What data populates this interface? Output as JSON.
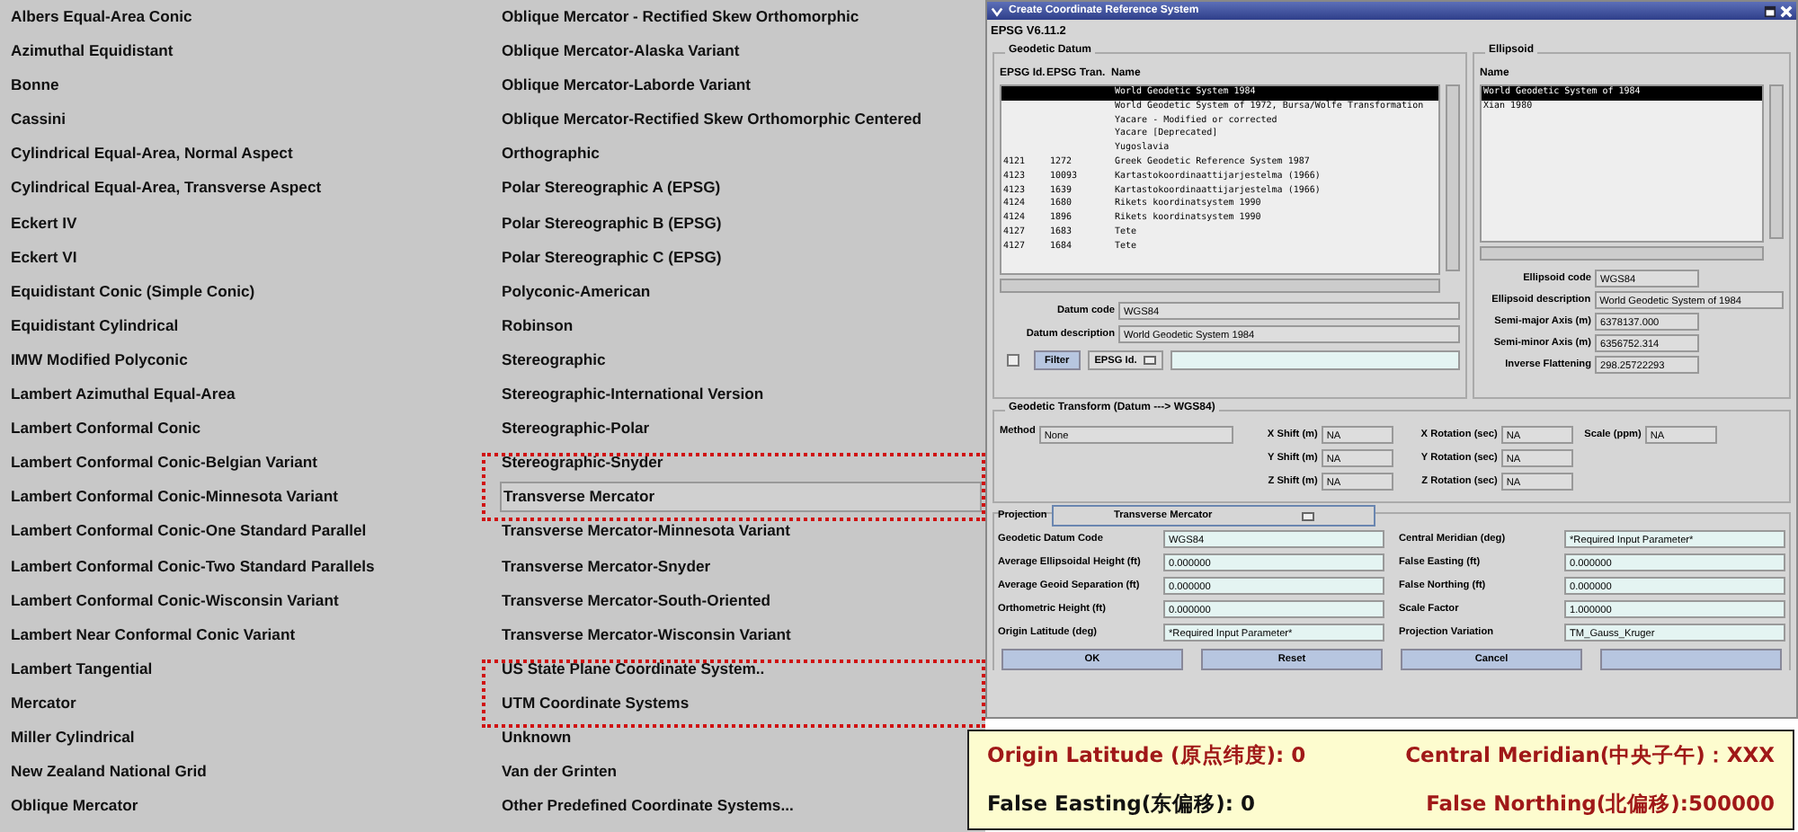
{
  "projections": [
    {
      "label": "Albers Equal-Area Conic",
      "selected": false,
      "marked": false
    },
    {
      "label": "Azimuthal Equidistant",
      "selected": false,
      "marked": false
    },
    {
      "label": "Bonne",
      "selected": false,
      "marked": false
    },
    {
      "label": "Cassini",
      "selected": false,
      "marked": false
    },
    {
      "label": "Cylindrical Equal-Area, Normal Aspect",
      "selected": false,
      "marked": false
    },
    {
      "label": "Cylindrical Equal-Area, Transverse Aspect",
      "selected": false,
      "marked": false
    },
    {
      "label": "Eckert IV",
      "selected": false,
      "marked": false
    },
    {
      "label": "Eckert VI",
      "selected": false,
      "marked": false
    },
    {
      "label": "Equidistant Conic (Simple Conic)",
      "selected": false,
      "marked": false
    },
    {
      "label": "Equidistant Cylindrical",
      "selected": false,
      "marked": false
    },
    {
      "label": "IMW Modified Polyconic",
      "selected": false,
      "marked": false
    },
    {
      "label": "Lambert Azimuthal Equal-Area",
      "selected": false,
      "marked": false
    },
    {
      "label": "Lambert Conformal Conic",
      "selected": false,
      "marked": false
    },
    {
      "label": "Lambert Conformal Conic-Belgian Variant",
      "selected": false,
      "marked": false
    },
    {
      "label": "Lambert Conformal Conic-Minnesota Variant",
      "selected": false,
      "marked": false
    },
    {
      "label": "Lambert Conformal Conic-One Standard Parallel",
      "selected": false,
      "marked": false
    },
    {
      "label": "Lambert Conformal Conic-Two Standard Parallels",
      "selected": false,
      "marked": false
    },
    {
      "label": "Lambert Conformal Conic-Wisconsin Variant",
      "selected": false,
      "marked": false
    },
    {
      "label": "Lambert Near Conformal Conic Variant",
      "selected": false,
      "marked": false
    },
    {
      "label": "Lambert Tangential",
      "selected": false,
      "marked": false
    },
    {
      "label": "Mercator",
      "selected": false,
      "marked": false
    },
    {
      "label": "Miller Cylindrical",
      "selected": false,
      "marked": false
    },
    {
      "label": "New Zealand National Grid",
      "selected": false,
      "marked": false
    },
    {
      "label": "Oblique Mercator",
      "selected": false,
      "marked": false
    },
    {
      "label": "Oblique Mercator - Rectified Skew Orthomorphic",
      "selected": false,
      "marked": false
    },
    {
      "label": "Oblique Mercator-Alaska Variant",
      "selected": false,
      "marked": false
    },
    {
      "label": "Oblique Mercator-Laborde Variant",
      "selected": false,
      "marked": false
    },
    {
      "label": "Oblique Mercator-Rectified Skew Orthomorphic Centered",
      "selected": false,
      "marked": false
    },
    {
      "label": "Orthographic",
      "selected": false,
      "marked": false
    },
    {
      "label": "Polar Stereographic A (EPSG)",
      "selected": false,
      "marked": false
    },
    {
      "label": "Polar Stereographic B (EPSG)",
      "selected": false,
      "marked": false
    },
    {
      "label": "Polar Stereographic C (EPSG)",
      "selected": false,
      "marked": false
    },
    {
      "label": "Polyconic-American",
      "selected": false,
      "marked": false
    },
    {
      "label": "Robinson",
      "selected": false,
      "marked": false
    },
    {
      "label": "Stereographic",
      "selected": false,
      "marked": false
    },
    {
      "label": "Stereographic-International Version",
      "selected": false,
      "marked": false
    },
    {
      "label": "Stereographic-Polar",
      "selected": false,
      "marked": false
    },
    {
      "label": "Stereographic-Snyder",
      "selected": false,
      "marked": false
    },
    {
      "label": "Transverse Mercator",
      "selected": true,
      "marked": true
    },
    {
      "label": "Transverse Mercator-Minnesota Variant",
      "selected": false,
      "marked": false
    },
    {
      "label": "Transverse Mercator-Snyder",
      "selected": false,
      "marked": false
    },
    {
      "label": "Transverse Mercator-South-Oriented",
      "selected": false,
      "marked": false
    },
    {
      "label": "Transverse Mercator-Wisconsin Variant",
      "selected": false,
      "marked": false
    },
    {
      "label": "US State Plane Coordinate System..",
      "selected": false,
      "marked": false
    },
    {
      "label": "UTM Coordinate Systems",
      "selected": false,
      "marked": true
    },
    {
      "label": "Unknown",
      "selected": false,
      "marked": false
    },
    {
      "label": "Van der Grinten",
      "selected": false,
      "marked": false
    },
    {
      "label": "Other Predefined Coordinate Systems...",
      "selected": false,
      "marked": false
    }
  ],
  "window": {
    "title": "Create Coordinate Reference System"
  },
  "version": "EPSG V6.11.2",
  "geodetic_datum": {
    "title": "Geodetic Datum",
    "columns": [
      "EPSG Id.",
      "EPSG Tran.",
      "Name"
    ],
    "rows": [
      {
        "epsg_id": "",
        "epsg_tran": "",
        "name": "World Geodetic System 1984",
        "selected": true
      },
      {
        "epsg_id": "",
        "epsg_tran": "",
        "name": "World Geodetic System of 1972, Bursa/Wolfe Transformation",
        "selected": false
      },
      {
        "epsg_id": "",
        "epsg_tran": "",
        "name": "Yacare - Modified or corrected",
        "selected": false
      },
      {
        "epsg_id": "",
        "epsg_tran": "",
        "name": "Yacare [Deprecated]",
        "selected": false
      },
      {
        "epsg_id": "",
        "epsg_tran": "",
        "name": "Yugoslavia",
        "selected": false
      },
      {
        "epsg_id": "4121",
        "epsg_tran": "1272",
        "name": "Greek Geodetic Reference System 1987",
        "selected": false
      },
      {
        "epsg_id": "4123",
        "epsg_tran": "10093",
        "name": "Kartastokoordinaattijarjestelma (1966)",
        "selected": false
      },
      {
        "epsg_id": "4123",
        "epsg_tran": "1639",
        "name": "Kartastokoordinaattijarjestelma (1966)",
        "selected": false
      },
      {
        "epsg_id": "4124",
        "epsg_tran": "1680",
        "name": "Rikets koordinatsystem 1990",
        "selected": false
      },
      {
        "epsg_id": "4124",
        "epsg_tran": "1896",
        "name": "Rikets koordinatsystem 1990",
        "selected": false
      },
      {
        "epsg_id": "4127",
        "epsg_tran": "1683",
        "name": "Tete",
        "selected": false
      },
      {
        "epsg_id": "4127",
        "epsg_tran": "1684",
        "name": "Tete",
        "selected": false
      }
    ],
    "fields": [
      {
        "label": "Datum code",
        "value": "WGS84"
      },
      {
        "label": "Datum description",
        "value": "World Geodetic System 1984"
      }
    ],
    "filter": {
      "checked": false,
      "button": "Filter",
      "dropdown": "EPSG Id."
    }
  },
  "ellipsoid": {
    "title": "Ellipsoid",
    "column": "Name",
    "rows": [
      {
        "name": "World Geodetic System of 1984",
        "selected": true
      },
      {
        "name": "Xian 1980",
        "selected": false
      }
    ],
    "fields": [
      {
        "label": "Ellipsoid code",
        "value": "WGS84"
      },
      {
        "label": "Ellipsoid description",
        "value": "World Geodetic System of 1984"
      },
      {
        "label": "Semi-major Axis (m)",
        "value": "6378137.000"
      },
      {
        "label": "Semi-minor Axis (m)",
        "value": "6356752.314"
      },
      {
        "label": "Inverse Flattening",
        "value": "298.25722293"
      }
    ]
  },
  "transform": {
    "title": "Geodetic Transform (Datum ---> WGS84)",
    "method_label": "Method",
    "method": "None",
    "rows": [
      [
        {
          "label": "X Shift (m)",
          "value": "NA"
        },
        {
          "label": "X Rotation (sec)",
          "value": "NA"
        },
        {
          "label": "Scale (ppm)",
          "value": "NA"
        }
      ],
      [
        {
          "label": "Y Shift (m)",
          "value": "NA"
        },
        {
          "label": "Y Rotation (sec)",
          "value": "NA"
        }
      ],
      [
        {
          "label": "Z Shift (m)",
          "value": "NA"
        },
        {
          "label": "Z Rotation (sec)",
          "value": "NA"
        }
      ]
    ]
  },
  "projection": {
    "label": "Projection",
    "value": "Transverse Mercator",
    "fields": [
      {
        "label": "Geodetic Datum Code",
        "value": "WGS84"
      },
      {
        "label": "Central Meridian (deg)",
        "value": "*Required Input Parameter*"
      },
      {
        "label": "Average Ellipsoidal Height (ft)",
        "value": "0.000000"
      },
      {
        "label": "False Easting (ft)",
        "value": "0.000000"
      },
      {
        "label": "Average Geoid Separation (ft)",
        "value": "0.000000"
      },
      {
        "label": "False Northing (ft)",
        "value": "0.000000"
      },
      {
        "label": "Orthometric Height (ft)",
        "value": "0.000000"
      },
      {
        "label": "Scale Factor",
        "value": "1.000000"
      },
      {
        "label": "Origin Latitude (deg)",
        "value": "*Required Input Parameter*"
      },
      {
        "label": "Projection Variation",
        "value": "TM_Gauss_Kruger"
      }
    ]
  },
  "buttons": [
    "OK",
    "Reset",
    "Cancel"
  ],
  "annotation": [
    {
      "text": "Origin Latitude (原点纬度): 0",
      "color": "#a01818"
    },
    {
      "text": "Central Meridian(中央子午)：XXX",
      "color": "#a01818"
    },
    {
      "text": "False Easting(东偏移): 0",
      "color": "#111111"
    },
    {
      "text": "False Northing(北偏移):500000",
      "color": "#a01818"
    }
  ]
}
